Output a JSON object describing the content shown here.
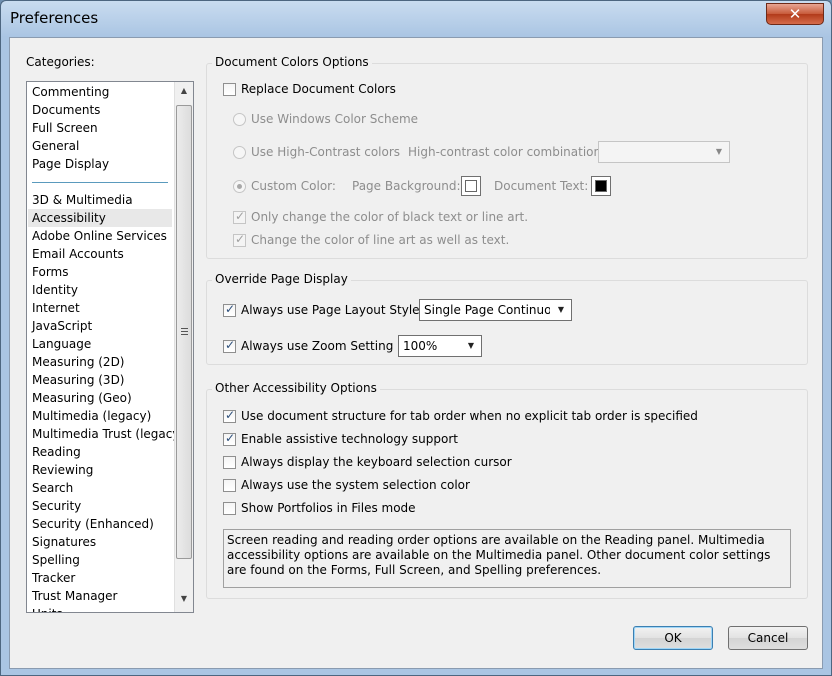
{
  "window": {
    "title": "Preferences"
  },
  "categories": {
    "label": "Categories:",
    "top_items": [
      "Commenting",
      "Documents",
      "Full Screen",
      "General",
      "Page Display"
    ],
    "items": [
      "3D & Multimedia",
      "Accessibility",
      "Adobe Online Services",
      "Email Accounts",
      "Forms",
      "Identity",
      "Internet",
      "JavaScript",
      "Language",
      "Measuring (2D)",
      "Measuring (3D)",
      "Measuring (Geo)",
      "Multimedia (legacy)",
      "Multimedia Trust (legacy)",
      "Reading",
      "Reviewing",
      "Search",
      "Security",
      "Security (Enhanced)",
      "Signatures",
      "Spelling",
      "Tracker",
      "Trust Manager",
      "Units"
    ],
    "selected": "Accessibility"
  },
  "doc_colors": {
    "title": "Document Colors Options",
    "replace": "Replace Document Colors",
    "use_windows": "Use Windows Color Scheme",
    "use_high_contrast": "Use High-Contrast colors",
    "high_contrast_combo_label": "High-contrast color combination:",
    "high_contrast_combo_value": "",
    "custom_color": "Custom Color:",
    "page_background": "Page Background:",
    "document_text": "Document Text:",
    "only_change_black": "Only change the color of black text or line art.",
    "change_line_art": "Change the color of line art as well as text.",
    "page_background_color": "#ffffff",
    "document_text_color": "#000000"
  },
  "override": {
    "title": "Override Page Display",
    "page_layout": "Always use Page Layout Style",
    "page_layout_value": "Single Page Continuous",
    "zoom": "Always use Zoom Setting",
    "zoom_value": "100%"
  },
  "other": {
    "title": "Other Accessibility Options",
    "tab_order": "Use document structure for tab order when no explicit tab order is specified",
    "assistive": "Enable assistive technology support",
    "keyboard_cursor": "Always display the keyboard selection cursor",
    "system_color": "Always use the system selection color",
    "portfolios": "Show Portfolios in Files mode",
    "note": "Screen reading and reading order options are available on the Reading panel. Multimedia accessibility options are available on the Multimedia panel. Other document color settings are found on the Forms, Full Screen, and Spelling preferences."
  },
  "buttons": {
    "ok": "OK",
    "cancel": "Cancel"
  },
  "icons": {
    "close": "close-icon",
    "scroll_up": "chevron-up-icon",
    "scroll_down": "chevron-down-icon",
    "dropdown": "chevron-down-icon"
  }
}
